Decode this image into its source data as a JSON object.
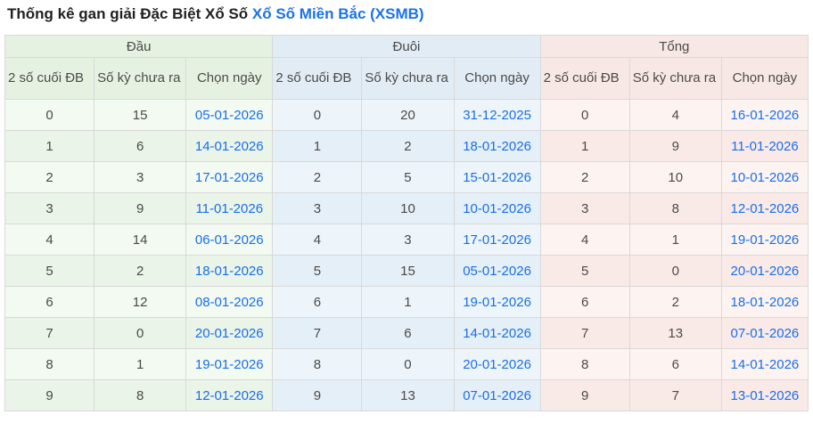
{
  "page": {
    "title_prefix": "Thống kê gan giải Đặc Biệt Xổ Số",
    "title_link": "Xổ Số Miền Bắc (XSMB)"
  },
  "colors": {
    "title_link_blue": "#1a73e8",
    "date_link_blue": "#1a6fe8",
    "dau_header_bg": "#e5f2e2",
    "duoi_header_bg": "#e2ecf4",
    "tong_header_bg": "#f8e8e5",
    "cell_border": "#d9d9d9"
  },
  "table": {
    "groups": [
      {
        "name": "Đầu",
        "columns": [
          "2 số cuối ĐB",
          "Số kỳ chưa ra",
          "Chọn ngày"
        ],
        "rows": [
          [
            "0",
            "15",
            "05-01-2026"
          ],
          [
            "1",
            "6",
            "14-01-2026"
          ],
          [
            "2",
            "3",
            "17-01-2026"
          ],
          [
            "3",
            "9",
            "11-01-2026"
          ],
          [
            "4",
            "14",
            "06-01-2026"
          ],
          [
            "5",
            "2",
            "18-01-2026"
          ],
          [
            "6",
            "12",
            "08-01-2026"
          ],
          [
            "7",
            "0",
            "20-01-2026"
          ],
          [
            "8",
            "1",
            "19-01-2026"
          ],
          [
            "9",
            "8",
            "12-01-2026"
          ]
        ]
      },
      {
        "name": "Đuôi",
        "columns": [
          "2 số cuối ĐB",
          "Số kỳ chưa ra",
          "Chọn ngày"
        ],
        "rows": [
          [
            "0",
            "20",
            "31-12-2025"
          ],
          [
            "1",
            "2",
            "18-01-2026"
          ],
          [
            "2",
            "5",
            "15-01-2026"
          ],
          [
            "3",
            "10",
            "10-01-2026"
          ],
          [
            "4",
            "3",
            "17-01-2026"
          ],
          [
            "5",
            "15",
            "05-01-2026"
          ],
          [
            "6",
            "1",
            "19-01-2026"
          ],
          [
            "7",
            "6",
            "14-01-2026"
          ],
          [
            "8",
            "0",
            "20-01-2026"
          ],
          [
            "9",
            "13",
            "07-01-2026"
          ]
        ]
      },
      {
        "name": "Tổng",
        "columns": [
          "2 số cuối ĐB",
          "Số kỳ chưa ra",
          "Chọn ngày"
        ],
        "rows": [
          [
            "0",
            "4",
            "16-01-2026"
          ],
          [
            "1",
            "9",
            "11-01-2026"
          ],
          [
            "2",
            "10",
            "10-01-2026"
          ],
          [
            "3",
            "8",
            "12-01-2026"
          ],
          [
            "4",
            "1",
            "19-01-2026"
          ],
          [
            "5",
            "0",
            "20-01-2026"
          ],
          [
            "6",
            "2",
            "18-01-2026"
          ],
          [
            "7",
            "13",
            "07-01-2026"
          ],
          [
            "8",
            "6",
            "14-01-2026"
          ],
          [
            "9",
            "7",
            "13-01-2026"
          ]
        ]
      }
    ]
  }
}
